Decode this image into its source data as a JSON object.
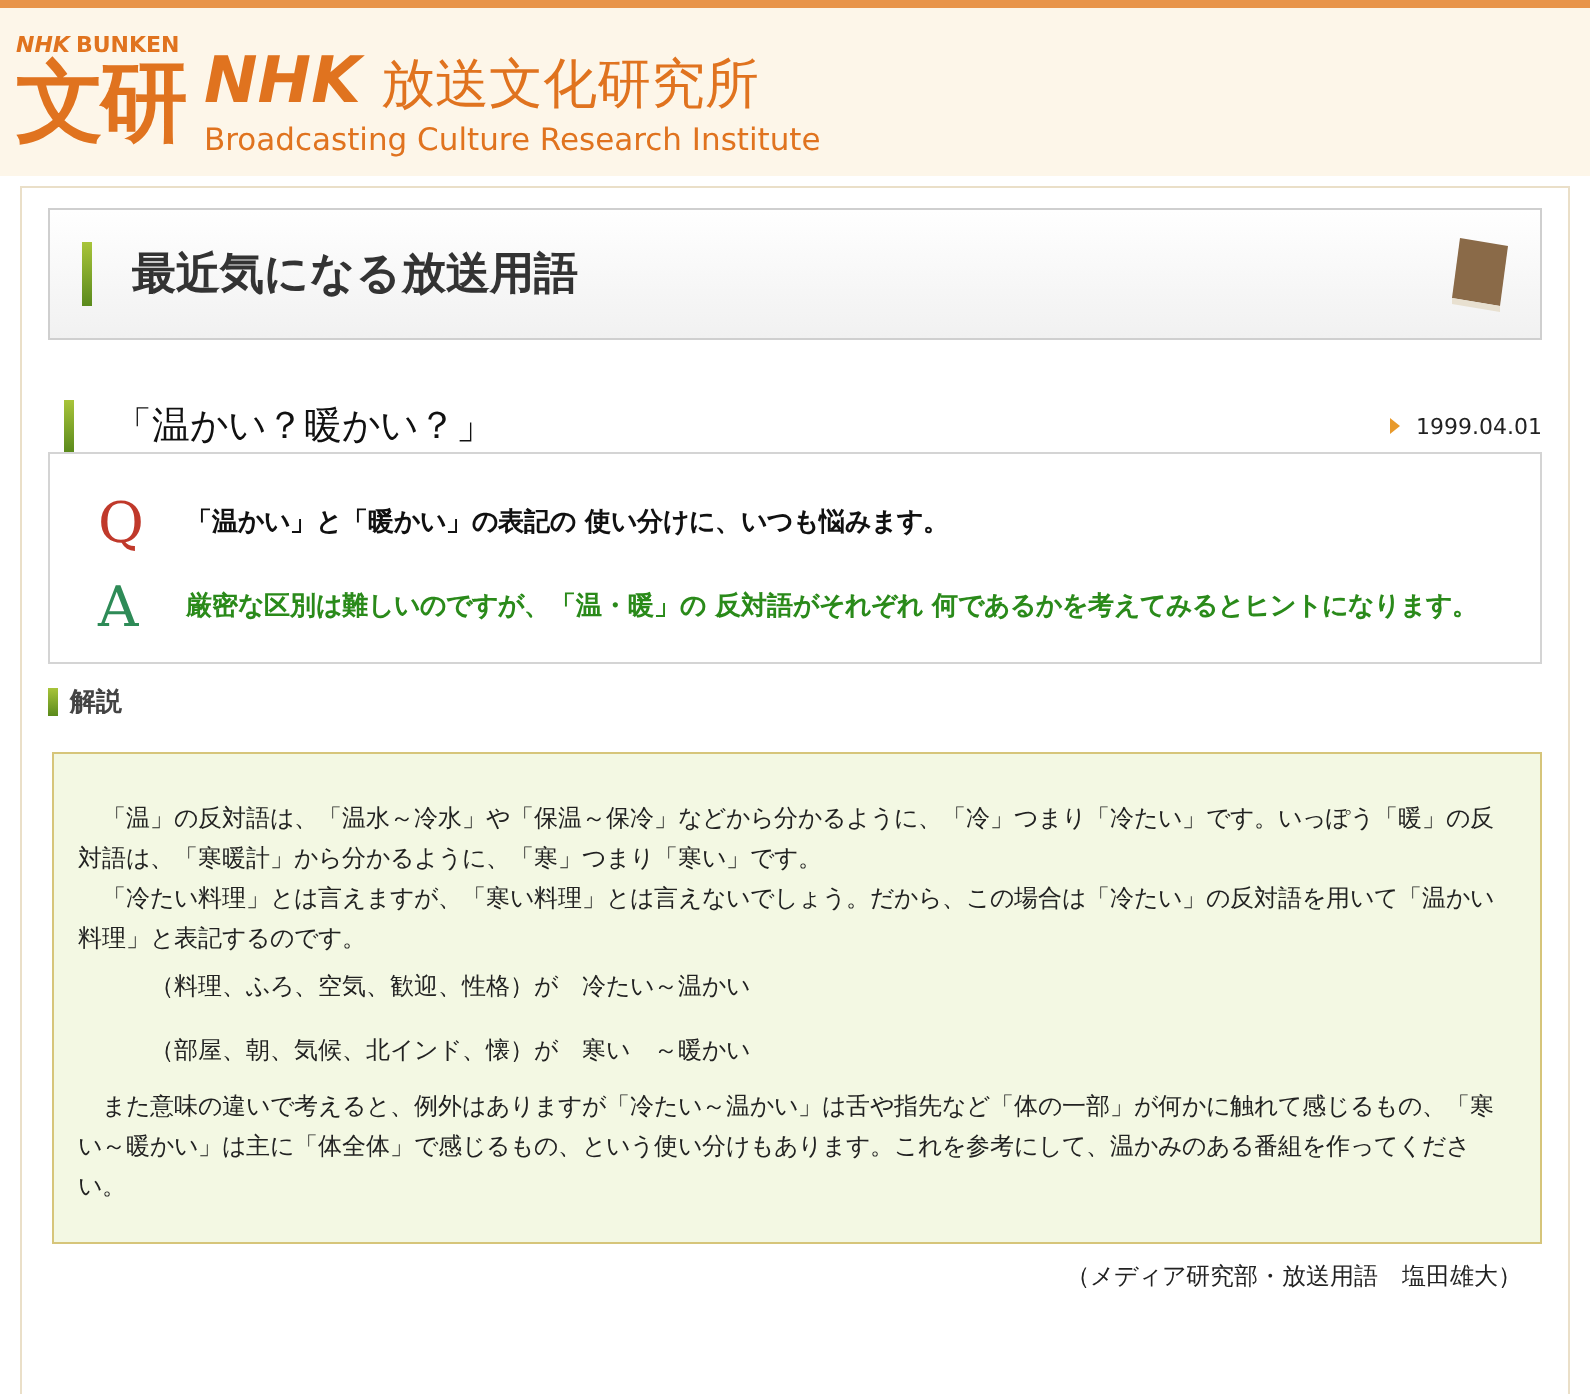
{
  "header": {
    "logo_small": "NHK",
    "logo_small_2": "BUNKEN",
    "logo_mark": "文研",
    "logo_nhk": "NHK",
    "logo_name": "放送文化研究所",
    "logo_english": "Broadcasting Culture Research Institute"
  },
  "section_title": "最近気になる放送用語",
  "article": {
    "title": "「温かい？暖かい？」",
    "date": "1999.04.01",
    "question_mark": "Q",
    "question": "「温かい」と「暖かい」の表記の 使い分けに、いつも悩みます。",
    "answer_mark": "A",
    "answer": "厳密な区別は難しいのですが、「温・暖」の 反対語がそれぞれ 何であるかを考えてみるとヒントになります。",
    "commentary_heading": "解説",
    "commentary": [
      {
        "kind": "paragraph",
        "text": "「温」の反対語は、「温水～冷水」や「保温～保冷」などから分かるように、「冷」つまり「冷たい」です。いっぽう「暖」の反対語は、「寒暖計」から分かるように、「寒」つまり「寒い」です。"
      },
      {
        "kind": "paragraph",
        "text": "「冷たい料理」とは言えますが、「寒い料理」とは言えないでしょう。だから、この場合は「冷たい」の反対語を用いて「温かい料理」と表記するのです。"
      },
      {
        "kind": "example",
        "text": "（料理、ふろ、空気、歓迎、性格）が　冷たい～温かい"
      },
      {
        "kind": "example",
        "text": "（部屋、朝、気候、北インド、懐）が　寒い　～暖かい"
      },
      {
        "kind": "paragraph",
        "text": "また意味の違いで考えると、例外はありますが「冷たい～温かい」は舌や指先など「体の一部」が何かに触れて感じるもの、「寒い～暖かい」は主に「体全体」で感じるもの、という使い分けもあります。これを参考にして、温かみのある番組を作ってください。"
      }
    ],
    "author": "（メディア研究部・放送用語　塩田雄大）"
  }
}
